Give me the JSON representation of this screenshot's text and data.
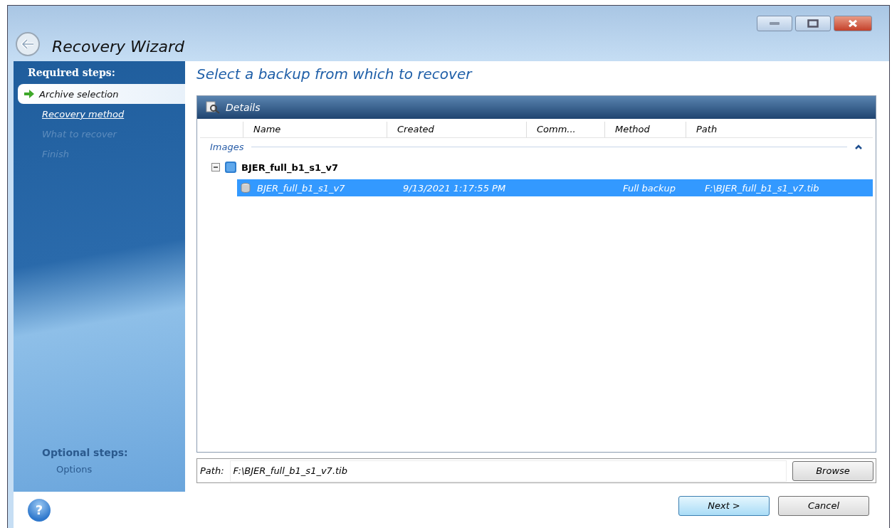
{
  "window": {
    "title": "Recovery Wizard"
  },
  "sidebar": {
    "heading": "Required steps:",
    "steps": [
      {
        "label": "Archive selection",
        "kind": "current"
      },
      {
        "label": "Recovery method",
        "kind": "link"
      },
      {
        "label": "What to recover",
        "kind": "disabled"
      },
      {
        "label": "Finish",
        "kind": "disabled"
      }
    ],
    "optional_heading": "Optional steps:",
    "optional_steps": [
      {
        "label": "Options",
        "kind": "disabled"
      }
    ]
  },
  "page_title": "Select a backup from which to recover",
  "details": {
    "title": "Details",
    "columns": [
      "Name",
      "Created",
      "Comm...",
      "Method",
      "Path"
    ],
    "groups": [
      {
        "label": "Images",
        "expanded": true,
        "children": [
          {
            "name": "BJER_full_b1_s1_v7",
            "expanded": true,
            "children": [
              {
                "cells": [
                  "BJER_full_b1_s1_v7",
                  "9/13/2021 1:17:55 PM",
                  "",
                  "Full backup",
                  "F:\\BJER_full_b1_s1_v7.tib"
                ],
                "selected": true
              }
            ]
          }
        ]
      }
    ]
  },
  "path_field": {
    "label": "Path:",
    "value": "F:\\BJER_full_b1_s1_v7.tib",
    "button": "Browse"
  },
  "help": "?",
  "buttons": [
    {
      "label": "Next >",
      "kind": "primary"
    },
    {
      "label": "Cancel",
      "kind": "normal"
    }
  ]
}
